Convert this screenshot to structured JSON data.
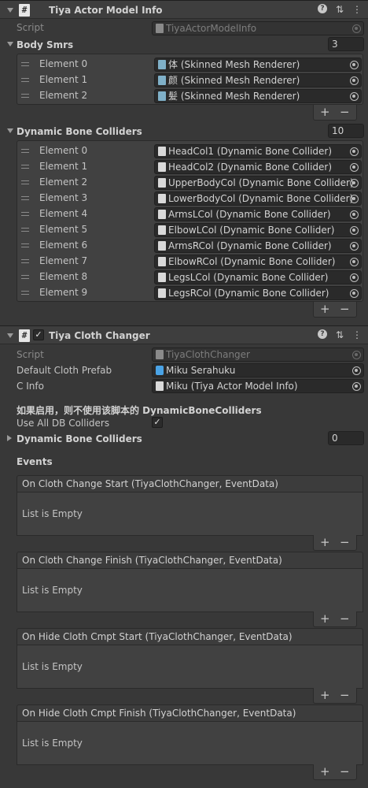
{
  "actor_model_info": {
    "title": "Tiya Actor Model Info",
    "script_label": "Script",
    "script_value": "TiyaActorModelInfo",
    "body_smrs": {
      "label": "Body Smrs",
      "count": "3",
      "items": [
        {
          "name": "Element 0",
          "value": "体 (Skinned Mesh Renderer)"
        },
        {
          "name": "Element 1",
          "value": "颜 (Skinned Mesh Renderer)"
        },
        {
          "name": "Element 2",
          "value": "髪 (Skinned Mesh Renderer)"
        }
      ]
    },
    "dynamic_bone_colliders": {
      "label": "Dynamic Bone Colliders",
      "count": "10",
      "items": [
        {
          "name": "Element 0",
          "value": "HeadCol1 (Dynamic Bone Collider)"
        },
        {
          "name": "Element 1",
          "value": "HeadCol2 (Dynamic Bone Collider)"
        },
        {
          "name": "Element 2",
          "value": "UpperBodyCol (Dynamic Bone Collider)"
        },
        {
          "name": "Element 3",
          "value": "LowerBodyCol (Dynamic Bone Collider)"
        },
        {
          "name": "Element 4",
          "value": "ArmsLCol (Dynamic Bone Collider)"
        },
        {
          "name": "Element 5",
          "value": "ElbowLCol (Dynamic Bone Collider)"
        },
        {
          "name": "Element 6",
          "value": "ArmsRCol (Dynamic Bone Collider)"
        },
        {
          "name": "Element 7",
          "value": "ElbowRCol (Dynamic Bone Collider)"
        },
        {
          "name": "Element 8",
          "value": "LegsLCol (Dynamic Bone Collider)"
        },
        {
          "name": "Element 9",
          "value": "LegsRCol (Dynamic Bone Collider)"
        }
      ]
    }
  },
  "cloth_changer": {
    "title": "Tiya Cloth Changer",
    "enabled": true,
    "script_label": "Script",
    "script_value": "TiyaClothChanger",
    "default_cloth_prefab_label": "Default Cloth Prefab",
    "default_cloth_prefab_value": "Miku Serahuku",
    "c_info_label": "C Info",
    "c_info_value": "Miku (Tiya Actor Model Info)",
    "note": "如果启用，则不使用该脚本的 DynamicBoneColliders",
    "use_all_db_label": "Use All DB Colliders",
    "use_all_db_checked": true,
    "dbc_label": "Dynamic Bone Colliders",
    "dbc_count": "0",
    "events_label": "Events",
    "events": [
      {
        "title": "On Cloth Change Start (TiyaClothChanger, EventData)",
        "empty": "List is Empty"
      },
      {
        "title": "On Cloth Change Finish (TiyaClothChanger, EventData)",
        "empty": "List is Empty"
      },
      {
        "title": "On Hide Cloth Cmpt Start (TiyaClothChanger, EventData)",
        "empty": "List is Empty"
      },
      {
        "title": "On Hide Cloth Cmpt Finish (TiyaClothChanger, EventData)",
        "empty": "List is Empty"
      }
    ]
  },
  "common": {
    "add_glyph": "+",
    "remove_glyph": "−",
    "settings_glyph": "⇅",
    "more_glyph": "⋮",
    "help_glyph": "?",
    "check_glyph": "✓",
    "hash_glyph": "#"
  },
  "colors": {
    "background": "#383838",
    "header": "#3e3e3e",
    "field": "#2a2a2a"
  }
}
